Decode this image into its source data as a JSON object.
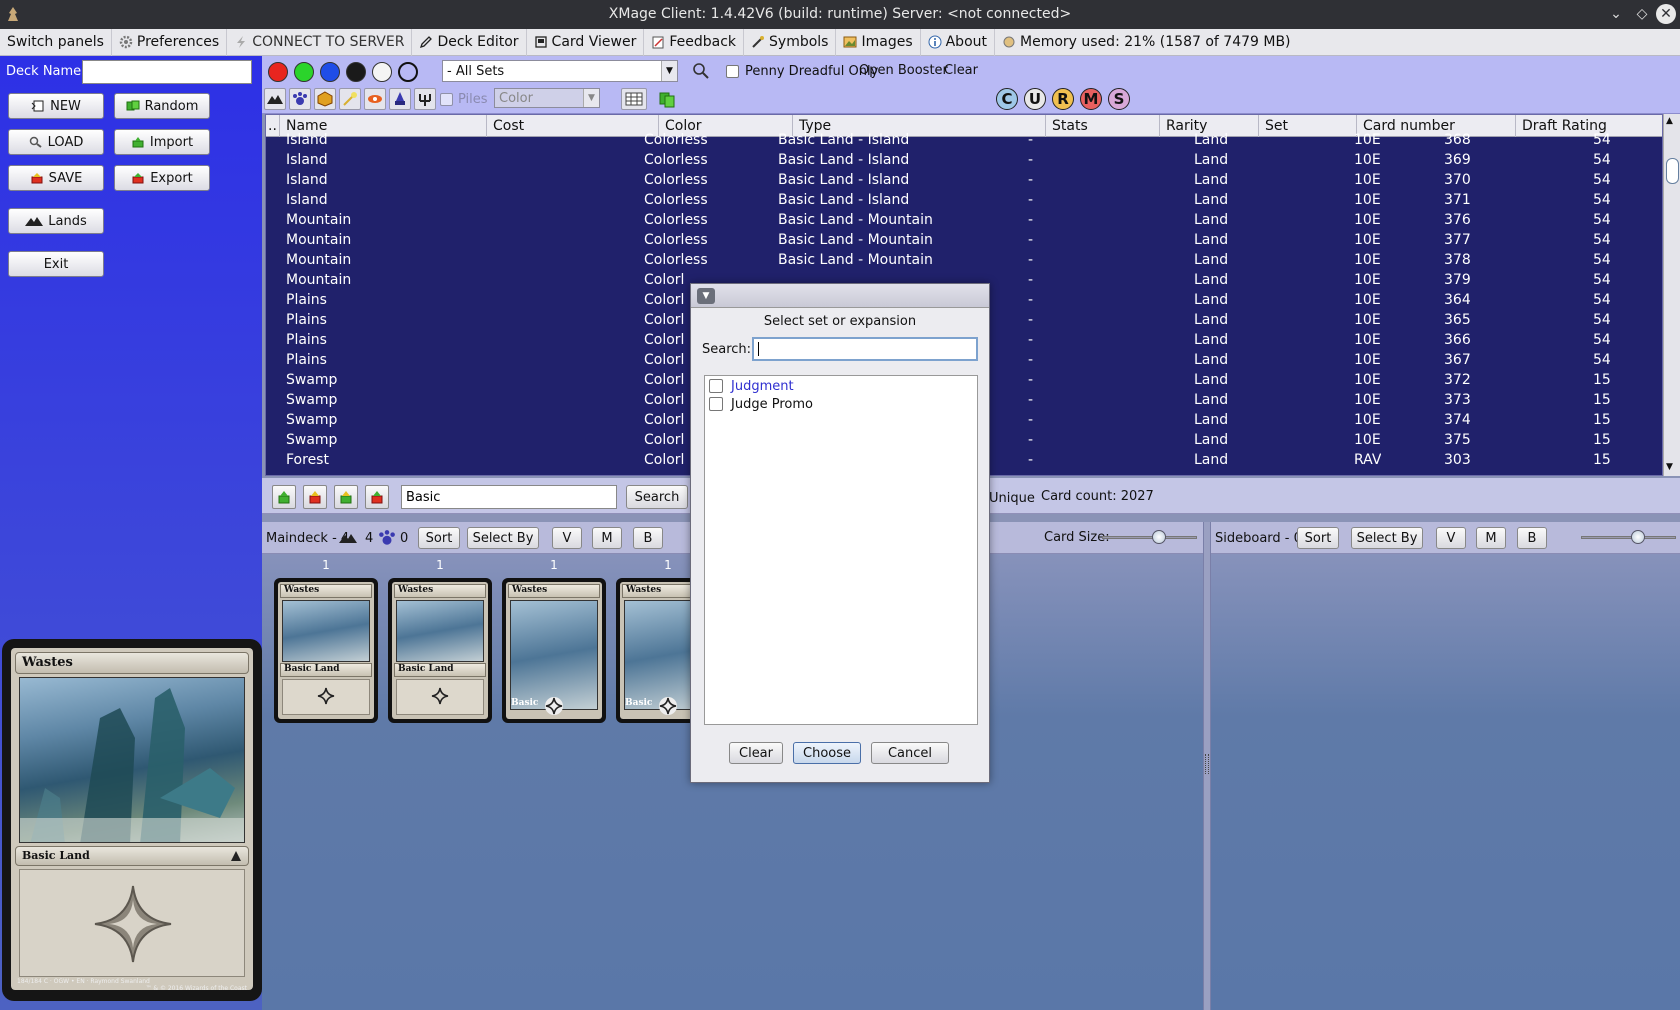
{
  "window": {
    "title": "XMage Client: 1.4.42V6 (build: runtime) Server: <not connected>"
  },
  "menubar": [
    {
      "id": "switch-panels",
      "label": "Switch panels",
      "icon": ""
    },
    {
      "id": "preferences",
      "label": "Preferences",
      "icon": "gear-icon"
    },
    {
      "id": "connect",
      "label": "CONNECT TO SERVER",
      "icon": "lightning-icon"
    },
    {
      "id": "deck-editor",
      "label": "Deck Editor",
      "icon": "pencil-icon"
    },
    {
      "id": "card-viewer",
      "label": "Card Viewer",
      "icon": "cards-icon"
    },
    {
      "id": "feedback",
      "label": "Feedback",
      "icon": "note-icon"
    },
    {
      "id": "symbols",
      "label": "Symbols",
      "icon": "wand-icon"
    },
    {
      "id": "images",
      "label": "Images",
      "icon": "picture-icon"
    },
    {
      "id": "about",
      "label": "About",
      "icon": "info-icon"
    },
    {
      "id": "memory",
      "label": "Memory used: 21% (1587 of 7479 MB)",
      "icon": "memory-icon"
    }
  ],
  "left": {
    "deck_name_label": "Deck Name:",
    "deck_name_value": "",
    "buttons": {
      "new": "NEW",
      "random": "Random",
      "load": "LOAD",
      "import": "Import",
      "save": "SAVE",
      "export": "Export",
      "lands": "Lands",
      "exit": "Exit"
    }
  },
  "preview_card": {
    "name": "Wastes",
    "type": "Basic Land",
    "footer_left": "184/184 C · OGW • EN · Raymond Swanland",
    "footer_right": "™ & © 2016 Wizards of the Coast"
  },
  "filter": {
    "set_select": "- All Sets",
    "penny_label": "Penny Dreadful Only",
    "open_booster": "Open Booster",
    "clear": "Clear",
    "piles_label": "Piles",
    "color_select": "Color",
    "mana_buttons": [
      "C",
      "U",
      "R",
      "M",
      "S"
    ],
    "colors": {
      "red": "#e8251f",
      "green": "#2bd42b",
      "blue": "#1f4de8",
      "black": "#1a1a1a",
      "white": "#f4f4f4"
    }
  },
  "table": {
    "columns": [
      "Name",
      "Cost",
      "Color",
      "Type",
      "Stats",
      "Rarity",
      "Set",
      "Card number",
      "Draft Rating"
    ],
    "rows": [
      [
        "Island",
        "",
        "Colorless",
        "Basic Land  - Island",
        "-",
        "Land",
        "10E",
        "368",
        "54"
      ],
      [
        "Island",
        "",
        "Colorless",
        "Basic Land  - Island",
        "-",
        "Land",
        "10E",
        "369",
        "54"
      ],
      [
        "Island",
        "",
        "Colorless",
        "Basic Land  - Island",
        "-",
        "Land",
        "10E",
        "370",
        "54"
      ],
      [
        "Island",
        "",
        "Colorless",
        "Basic Land  - Island",
        "-",
        "Land",
        "10E",
        "371",
        "54"
      ],
      [
        "Mountain",
        "",
        "Colorless",
        "Basic Land  - Mountain",
        "-",
        "Land",
        "10E",
        "376",
        "54"
      ],
      [
        "Mountain",
        "",
        "Colorless",
        "Basic Land  - Mountain",
        "-",
        "Land",
        "10E",
        "377",
        "54"
      ],
      [
        "Mountain",
        "",
        "Colorless",
        "Basic Land  - Mountain",
        "-",
        "Land",
        "10E",
        "378",
        "54"
      ],
      [
        "Mountain",
        "",
        "Colorl",
        "",
        "-",
        "Land",
        "10E",
        "379",
        "54"
      ],
      [
        "Plains",
        "",
        "Colorl",
        "",
        "-",
        "Land",
        "10E",
        "364",
        "54"
      ],
      [
        "Plains",
        "",
        "Colorl",
        "",
        "-",
        "Land",
        "10E",
        "365",
        "54"
      ],
      [
        "Plains",
        "",
        "Colorl",
        "",
        "-",
        "Land",
        "10E",
        "366",
        "54"
      ],
      [
        "Plains",
        "",
        "Colorl",
        "",
        "-",
        "Land",
        "10E",
        "367",
        "54"
      ],
      [
        "Swamp",
        "",
        "Colorl",
        "",
        "-",
        "Land",
        "10E",
        "372",
        "15"
      ],
      [
        "Swamp",
        "",
        "Colorl",
        "",
        "-",
        "Land",
        "10E",
        "373",
        "15"
      ],
      [
        "Swamp",
        "",
        "Colorl",
        "",
        "-",
        "Land",
        "10E",
        "374",
        "15"
      ],
      [
        "Swamp",
        "",
        "Colorl",
        "",
        "-",
        "Land",
        "10E",
        "375",
        "15"
      ],
      [
        "Forest",
        "",
        "Colorl",
        "",
        "-",
        "Land",
        "RAV",
        "303",
        "15"
      ]
    ]
  },
  "searchbar": {
    "search_value": "Basic",
    "search_button": "Search",
    "unique_label": "Unique",
    "card_count": "Card count:  2027"
  },
  "maindeck": {
    "label": "Maindeck - 4",
    "lands_count": "4",
    "creatures_count": "0",
    "sort": "Sort",
    "select_by": "Select By",
    "v": "V",
    "m": "M",
    "b": "B",
    "card_size_label": "Card Size:",
    "card_size_level": 0.6,
    "cards": [
      {
        "count": "1",
        "name": "Wastes",
        "type": "Basic Land",
        "style": "old"
      },
      {
        "count": "1",
        "name": "Wastes",
        "type": "Basic Land",
        "style": "old"
      },
      {
        "count": "1",
        "name": "Wastes",
        "type": "Basic",
        "style": "full"
      },
      {
        "count": "1",
        "name": "Wastes",
        "type": "Basic",
        "style": "full"
      }
    ]
  },
  "sideboard": {
    "label": "Sideboard - 0",
    "sort": "Sort",
    "select_by": "Select By",
    "v": "V",
    "m": "M",
    "b": "B",
    "slider_level": 0.6
  },
  "dialog": {
    "subtitle": "Select set or expansion",
    "search_label": "Search:",
    "search_value": "",
    "items": [
      {
        "label": "Judgment",
        "highlight": true
      },
      {
        "label": "Judge Promo",
        "highlight": false
      }
    ],
    "buttons": {
      "clear": "Clear",
      "choose": "Choose",
      "cancel": "Cancel"
    }
  }
}
